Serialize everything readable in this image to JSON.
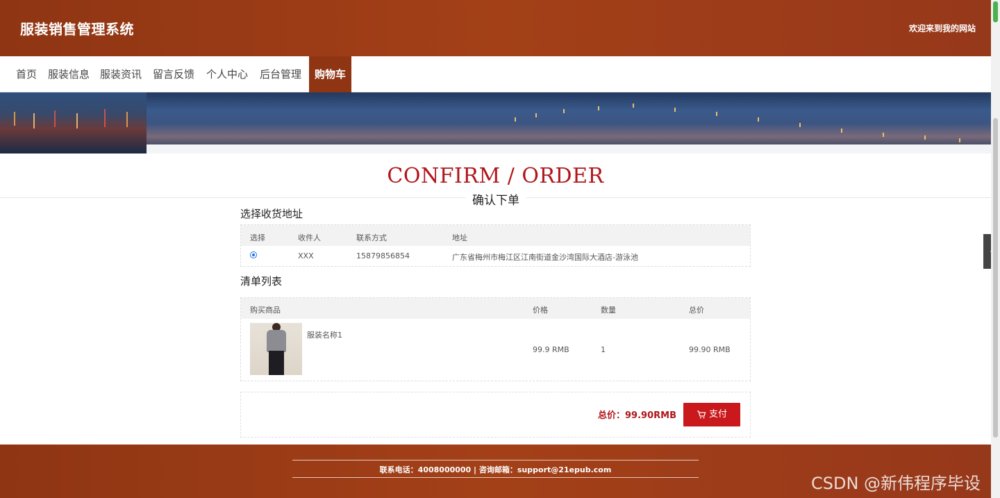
{
  "header": {
    "site_title": "服装销售管理系统",
    "welcome": "欢迎来到我的网站"
  },
  "nav": {
    "items": [
      {
        "label": "首页"
      },
      {
        "label": "服装信息"
      },
      {
        "label": "服装资讯"
      },
      {
        "label": "留言反馈"
      },
      {
        "label": "个人中心"
      },
      {
        "label": "后台管理"
      },
      {
        "label": "购物车",
        "active": true
      }
    ]
  },
  "page": {
    "title_en": "CONFIRM / ORDER",
    "title_cn": "确认下单"
  },
  "address_section": {
    "title": "选择收货地址",
    "headers": [
      "选择",
      "收件人",
      "联系方式",
      "地址"
    ],
    "rows": [
      {
        "selected": true,
        "recipient": "XXX",
        "phone": "15879856854",
        "address": "广东省梅州市梅江区江南街道金沙湾国际大酒店-游泳池"
      }
    ]
  },
  "order_section": {
    "title": "清单列表",
    "headers": [
      "购买商品",
      "价格",
      "数量",
      "总价"
    ],
    "rows": [
      {
        "name": "服装名称1",
        "price": "99.9 RMB",
        "quantity": "1",
        "total": "99.90 RMB"
      }
    ]
  },
  "summary": {
    "total_label": "总价：99.90RMB",
    "pay_label": "支付"
  },
  "footer": {
    "contact": "联系电话：4008000000 | 咨询邮箱：support@21epub.com"
  },
  "watermark": "CSDN @新伟程序毕设",
  "colors": {
    "brand": "#8f3513",
    "accent_red": "#c9191c",
    "title_red": "#b0161a"
  }
}
